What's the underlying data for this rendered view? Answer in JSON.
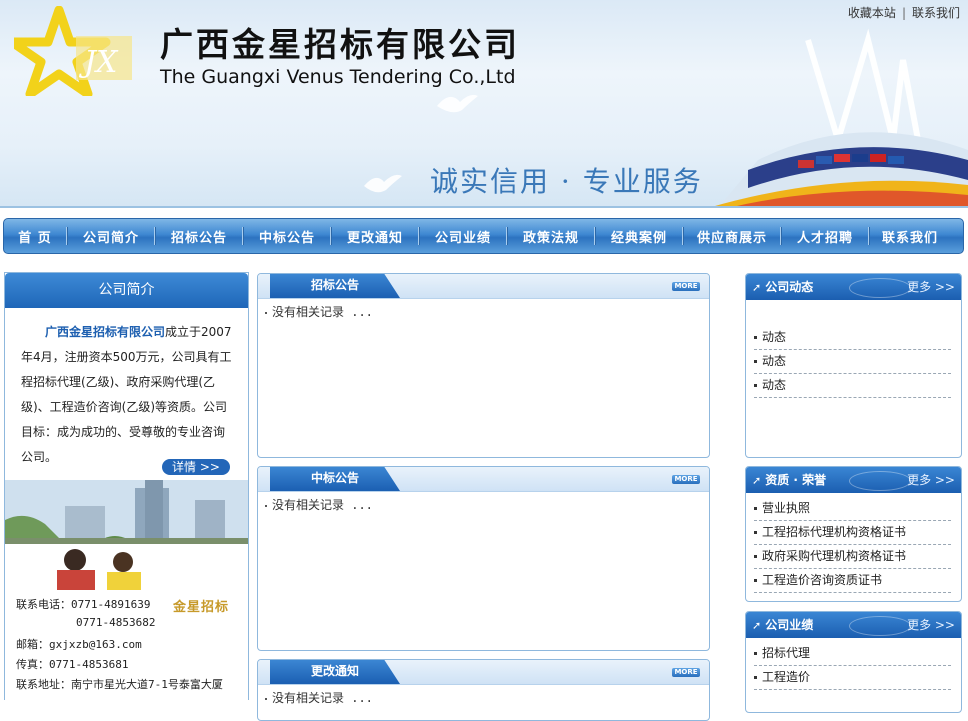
{
  "header": {
    "company_cn": "广西金星招标有限公司",
    "company_en": "The Guangxi Venus Tendering Co.,Ltd",
    "logo_letters": "JX",
    "slogan": "诚实信用 · 专业服务",
    "top_links": [
      "收藏本站",
      "联系我们"
    ],
    "top_sep": "|"
  },
  "nav": {
    "items": [
      "首 页",
      "公司简介",
      "招标公告",
      "中标公告",
      "更改通知",
      "公司业绩",
      "政策法规",
      "经典案例",
      "供应商展示",
      "人才招聘",
      "联系我们"
    ]
  },
  "left": {
    "title": "公司简介",
    "intro_company": "广西金星招标有限公司",
    "intro_text": "成立于2007年4月，注册资本500万元，公司具有工程招标代理(乙级)、政府采购代理(乙级)、工程造价咨询(乙级)等资质。公司目标：成为成功的、受尊敬的专业咨询公司。",
    "detail_btn": "详情 >>",
    "brand_stamp": "金星招标",
    "contact": {
      "phone_label": "联系电话：",
      "phone1": "0771-4891639",
      "phone2": "0771-4853682",
      "email_label": "邮箱：",
      "email": "gxjxzb@163.com",
      "fax_label": "传真：",
      "fax": "0771-4853681",
      "addr_label": "联系地址：",
      "addr": "南宁市星光大道7-1号泰富大厦"
    }
  },
  "mid_panels": [
    {
      "title": "招标公告",
      "more": "MORE",
      "empty": "没有相关记录 ..."
    },
    {
      "title": "中标公告",
      "more": "MORE",
      "empty": "没有相关记录 ..."
    },
    {
      "title": "更改通知",
      "more": "MORE",
      "empty": "没有相关记录 ..."
    }
  ],
  "right_panels": [
    {
      "title": "公司动态",
      "more": "更多 >>",
      "items": [
        "动态",
        "动态",
        "动态"
      ]
    },
    {
      "title": "资质 · 荣誉",
      "more": "更多 >>",
      "items": [
        "营业执照",
        "工程招标代理机构资格证书",
        "政府采购代理机构资格证书",
        "工程造价咨询资质证书"
      ]
    },
    {
      "title": "公司业绩",
      "more": "更多 >>",
      "items": [
        "招标代理",
        "工程造价"
      ]
    }
  ],
  "colors": {
    "brand_blue": "#1e66b8",
    "nav_blue": "#3f88d2",
    "slogan_blue": "#3a78b8",
    "star_yellow": "#f2d21a"
  },
  "icons": [
    "star-logo",
    "arrow-icon",
    "more-badge"
  ]
}
